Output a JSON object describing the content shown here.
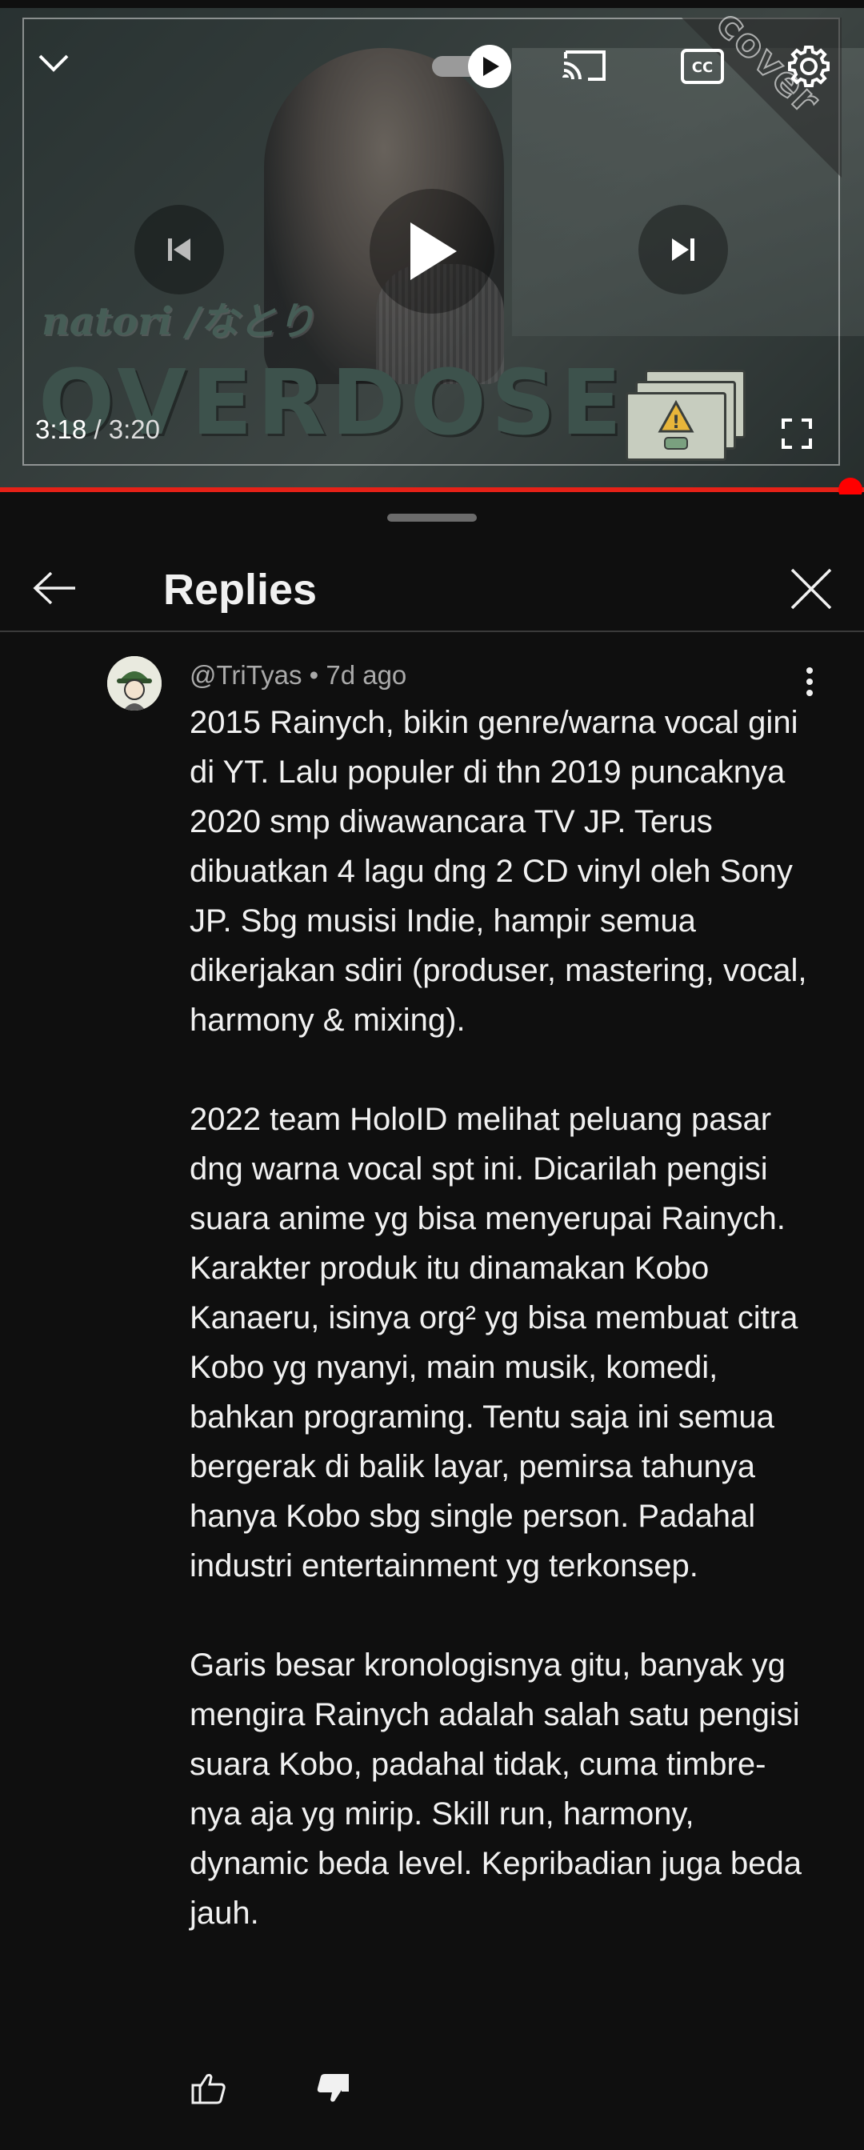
{
  "player": {
    "thumbnail": {
      "artist_text": "natori /なとり",
      "song_text": "OVERDOSE",
      "corner_text": "cover"
    },
    "current_time": "3:18",
    "separator": " / ",
    "duration": "3:20",
    "progress": 0.99,
    "autoplay_on": true,
    "icons": {
      "collapse": "chevron-down-icon",
      "autoplay": "autoplay-toggle-icon",
      "cast": "cast-icon",
      "captions": "closed-captions-icon",
      "settings": "gear-icon",
      "previous": "skip-previous-icon",
      "play": "play-icon",
      "next": "skip-next-icon",
      "fullscreen": "fullscreen-icon"
    },
    "colors": {
      "progress": "#ff0000"
    }
  },
  "replies_panel": {
    "title": "Replies",
    "icons": {
      "back": "arrow-left-icon",
      "close": "close-icon"
    }
  },
  "comment": {
    "author": "@TriTyas",
    "dot": " • ",
    "time": "7d ago",
    "paragraphs": [
      "2015 Rainych, bikin genre/warna vocal gini di YT. Lalu populer di thn 2019 puncaknya 2020 smp diwawancara TV JP. Terus dibuatkan 4 lagu dng 2 CD vinyl oleh Sony JP. Sbg musisi Indie, hampir semua dikerjakan sdiri (produser, mastering, vocal, harmony & mixing).",
      "2022 team HoloID melihat peluang pasar dng warna vocal spt ini. Dicarilah pengisi suara anime yg bisa menyerupai Rainych. Karakter produk itu dinamakan Kobo Kanaeru, isinya org² yg bisa membuat citra Kobo yg nyanyi, main musik, komedi, bahkan programing. Tentu saja ini semua bergerak di balik layar, pemirsa tahunya hanya Kobo sbg single person. Padahal industri entertainment yg terkonsep.",
      "Garis besar kronologisnya gitu, banyak yg mengira Rainych adalah salah satu pengisi suara Kobo, padahal tidak, cuma timbre-nya aja yg mirip. Skill run, harmony, dynamic beda level. Kepribadian juga beda jauh."
    ],
    "icons": {
      "more": "more-vertical-icon",
      "like": "thumbs-up-icon",
      "dislike": "thumbs-down-icon"
    }
  }
}
